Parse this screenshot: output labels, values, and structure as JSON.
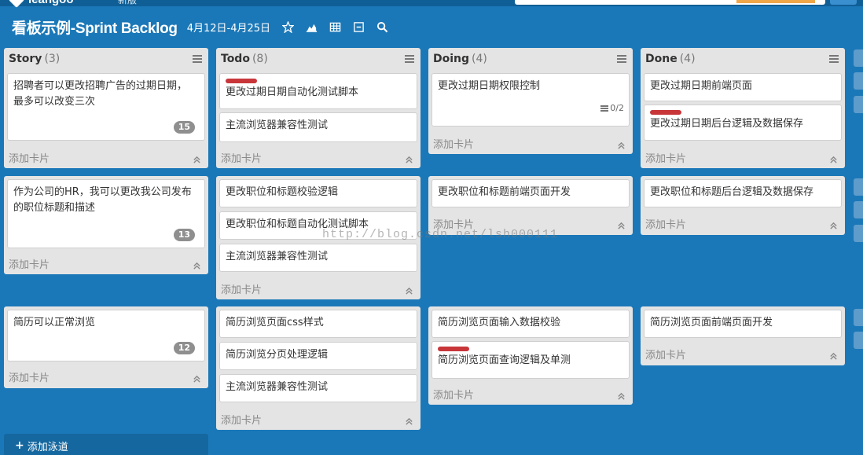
{
  "topbar": {
    "brand": "leangoo",
    "notification": "新版",
    "search_placeholder": ""
  },
  "board": {
    "title": "看板示例-Sprint Backlog",
    "dates": "4月12日-4月25日",
    "icons": [
      "star-icon",
      "chart-icon",
      "grid-icon",
      "minimize-icon",
      "search-icon"
    ]
  },
  "columns": [
    {
      "name": "Story",
      "count": "(3)"
    },
    {
      "name": "Todo",
      "count": "(8)"
    },
    {
      "name": "Doing",
      "count": "(4)"
    },
    {
      "name": "Done",
      "count": "(4)"
    }
  ],
  "add_card_label": "添加卡片",
  "lanes": [
    {
      "story": {
        "text": "招聘者可以更改招聘广告的过期日期，最多可以改变三次",
        "badge": "15"
      },
      "todo": [
        {
          "text": "更改过期日期自动化测试脚本",
          "label": true
        },
        {
          "text": "主流浏览器兼容性测试",
          "label": false
        }
      ],
      "doing": [
        {
          "text": "更改过期日期权限控制",
          "checklist": "0/2"
        }
      ],
      "done": [
        {
          "text": "更改过期日期前端页面",
          "label": false
        },
        {
          "text": "更改过期日期后台逻辑及数据保存",
          "label": true
        }
      ]
    },
    {
      "story": {
        "text": "作为公司的HR，我可以更改我公司发布的职位标题和描述",
        "badge": "13"
      },
      "todo": [
        {
          "text": "更改职位和标题校验逻辑"
        },
        {
          "text": "更改职位和标题自动化测试脚本"
        },
        {
          "text": "主流浏览器兼容性测试"
        }
      ],
      "doing": [
        {
          "text": "更改职位和标题前端页面开发"
        }
      ],
      "done": [
        {
          "text": "更改职位和标题后台逻辑及数据保存"
        }
      ]
    },
    {
      "story": {
        "text": "简历可以正常浏览",
        "badge": "12"
      },
      "todo": [
        {
          "text": "简历浏览页面css样式"
        },
        {
          "text": "简历浏览分页处理逻辑"
        },
        {
          "text": "主流浏览器兼容性测试"
        }
      ],
      "doing": [
        {
          "text": "简历浏览页面输入数据校验",
          "label": false
        },
        {
          "text": "简历浏览页面查询逻辑及单测",
          "label": true
        }
      ],
      "done": [
        {
          "text": "简历浏览页面前端页面开发"
        }
      ]
    }
  ],
  "add_lane_label": "添加泳道",
  "watermark": "http://blog.csdn.net/lsh000111",
  "colors": {
    "background": "#1b78b8",
    "column": "#e4e4e4",
    "label_red": "#c8363a",
    "badge": "#8f8f8f"
  }
}
